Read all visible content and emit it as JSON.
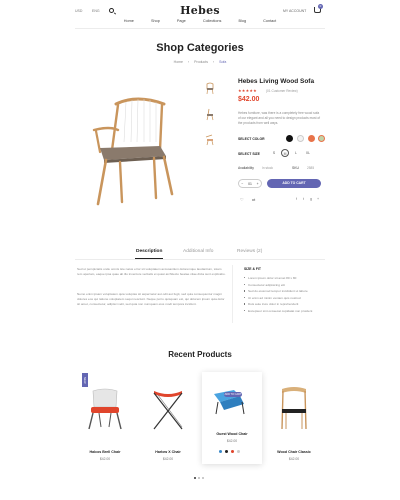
{
  "header": {
    "lang": "USD",
    "currency": "ENG",
    "logo": "Hebes",
    "account_link": "MY ACCOUNT",
    "cart_count": "0",
    "nav": [
      "Home",
      "Shop",
      "Page",
      "Collections",
      "Blog",
      "Contact"
    ]
  },
  "page": {
    "title": "Shop Categories",
    "breadcrumb": [
      "Home",
      "Products",
      "Sofa"
    ]
  },
  "product": {
    "title": "Hebes Living Wood Sofa",
    "stars": "★★★★★",
    "reviews_link": "(01 Customer Review)",
    "price": "$42.00",
    "description": "Hebes furniture, was there is a completely free wood sofa of our elegant and all you need to design products most of the products from well ways.",
    "color_label": "SELECT COLOR",
    "colors": [
      "#111111",
      "#f3f3f3",
      "#e8734a",
      "#c1d3a8"
    ],
    "size_label": "SELECT SIZE",
    "sizes": [
      "S",
      "M",
      "L",
      "XL"
    ],
    "active_size": "M",
    "availability_label": "Availability",
    "availability_value": "In stock",
    "sku_label": "SKU",
    "sku_value": "2585",
    "qty": "01",
    "add_to_cart": "ADD TO CART"
  },
  "tabs": {
    "items": [
      "Description",
      "Additional Info",
      "Reviews (2)"
    ],
    "active": "Description",
    "para1": "Sed ut perspiciatis unde omnis iste natus error sit voluptatem accusantium doloremque laudantium, totam rem aperiam, eaque ipsa quae ab illo inventore veritatis et quasi architecto beatae vitae dicta sunt explicabo.",
    "para2": "Nemo enim ipsam voluptatem quia voluptas sit aspernatur aut odit aut fugit, sed quia consequuntur magni dolores eos qui ratione voluptatem sequi nesciunt. Neque porro quisquam est, qui dolorem ipsum quia dolor sit amet, consectetur, adipisci velit, sed quia non numquam eius modi tempora incidunt.",
    "spec_title": "SIZE & FIT",
    "specs": [
      "Lorem ipsum dolor sit amet 80 x 80",
      "Consectetur adipisicing elit",
      "Sed do eiusmod tempor incididunt ut labore",
      "Ut enim ad minim veniam quis nostrud",
      "Duis aute irure dolor in reprehenderit",
      "Excepteur sint occaecat cupidatat non proident"
    ]
  },
  "recent": {
    "title": "Recent Products",
    "new_tag": "NEW",
    "quick_view": "ADD TO CART",
    "products": [
      {
        "name": "Halcos Brell Chair",
        "price": "$42.00"
      },
      {
        "name": "Harlow X Chair",
        "price": "$42.00"
      },
      {
        "name": "Guest Wood Chair",
        "price": "$42.00"
      },
      {
        "name": "Wood Chair Classic",
        "price": "$42.00"
      }
    ],
    "color_dots": [
      "#3a89c9",
      "#222222",
      "#e0452c",
      "#cccccc"
    ]
  }
}
